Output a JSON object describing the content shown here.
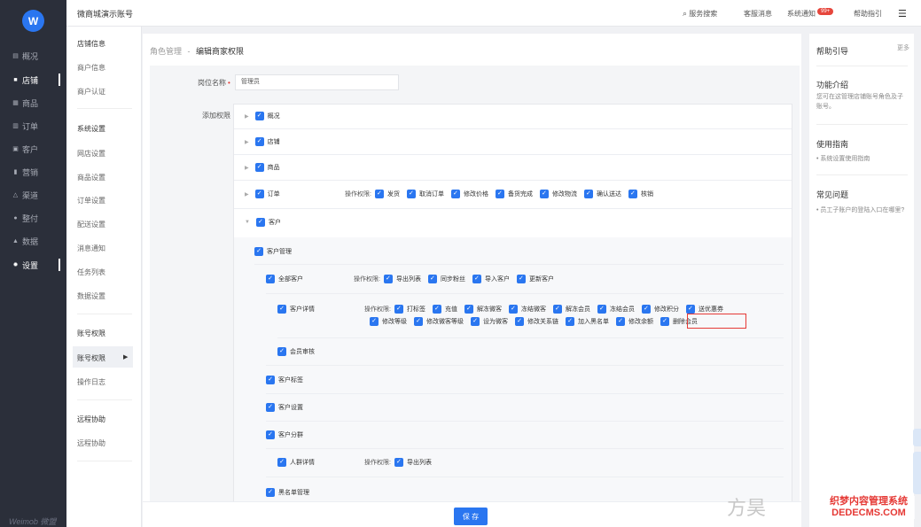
{
  "rail": {
    "logo_text": "W",
    "items": [
      {
        "label": "概况",
        "icon": "chart-icon"
      },
      {
        "label": "店铺",
        "icon": "store-icon"
      },
      {
        "label": "商品",
        "icon": "goods-icon"
      },
      {
        "label": "订单",
        "icon": "order-icon"
      },
      {
        "label": "客户",
        "icon": "customer-icon"
      },
      {
        "label": "营销",
        "icon": "marketing-icon"
      },
      {
        "label": "渠道",
        "icon": "channel-icon"
      },
      {
        "label": "整付",
        "icon": "pay-icon"
      },
      {
        "label": "数据",
        "icon": "data-icon"
      },
      {
        "label": "设置",
        "icon": "gear-icon"
      }
    ],
    "brand": "Weimob 微盟"
  },
  "subnav": {
    "store_info": "店铺信息",
    "merchant_info": "商户信息",
    "merchant_auth": "商户认证",
    "system_settings": "系统设置",
    "items": [
      "网店设置",
      "商品设置",
      "订单设置",
      "配送设置",
      "消息通知",
      "任务列表",
      "数据设置"
    ],
    "account_perm": "账号权限",
    "account_perm_item": "账号权限",
    "operation_log": "操作日志",
    "remote_assist": "远程协助",
    "remote_assist_item": "远程协助"
  },
  "topbar": {
    "shop_name": "微商城演示账号",
    "search": "服务搜索",
    "service_msg": "客服消息",
    "sys_notice": "系统通知",
    "badge": "99+",
    "help": "帮助指引"
  },
  "breadcrumb": {
    "parent": "角色管理",
    "sep": "-",
    "current": "编辑商家权限"
  },
  "form": {
    "name_label": "岗位名称",
    "required": "•",
    "name_value": "管理员",
    "add_perm_label": "添加权限"
  },
  "perms": {
    "ops_caption": "操作权限:",
    "top": [
      "概况",
      "店铺",
      "商品",
      "订单",
      "客户"
    ],
    "order_ops": [
      "发货",
      "取消订单",
      "修改价格",
      "备货完成",
      "修改物流",
      "确认送达",
      "核销"
    ],
    "customer_mgmt": "客户管理",
    "all_customers": "全部客户",
    "all_customers_ops": [
      "导出列表",
      "同步粉丝",
      "导入客户",
      "更新客户"
    ],
    "customer_detail": "客户详情",
    "detail_ops_row1": [
      "打标签",
      "充值",
      "解冻微客",
      "冻结微客",
      "解冻会员",
      "冻结会员",
      "修改积分",
      "送优惠券"
    ],
    "detail_ops_row2": [
      "修改等级",
      "修改微客等级",
      "设为微客",
      "修改关系链",
      "加入黑名单",
      "修改余额",
      "删除会员"
    ],
    "member_review": "会员审核",
    "customer_tags": "客户标签",
    "customer_settings": "客户设置",
    "customer_groups": "客户分群",
    "group_detail": "人群详情",
    "group_detail_ops": [
      "导出列表"
    ],
    "blacklist": "黑名单管理"
  },
  "save_label": "保 存",
  "help": {
    "title": "帮助引导",
    "more": "更多",
    "s1_title": "功能介绍",
    "s1_text": "您可在这管理店铺账号角色及子账号。",
    "s2_title": "使用指南",
    "s2_item": "• 系统设置使用指南",
    "s3_title": "常见问题",
    "s3_item": "• 员工子账户的登陆入口在哪里?"
  },
  "overlay": {
    "watermark": "方昊",
    "dede": "织梦内容管理系统 DEDECMS.COM"
  },
  "colors": {
    "accent": "#2a76f0",
    "rail": "#2b2f3a",
    "highlight": "#e53935"
  }
}
